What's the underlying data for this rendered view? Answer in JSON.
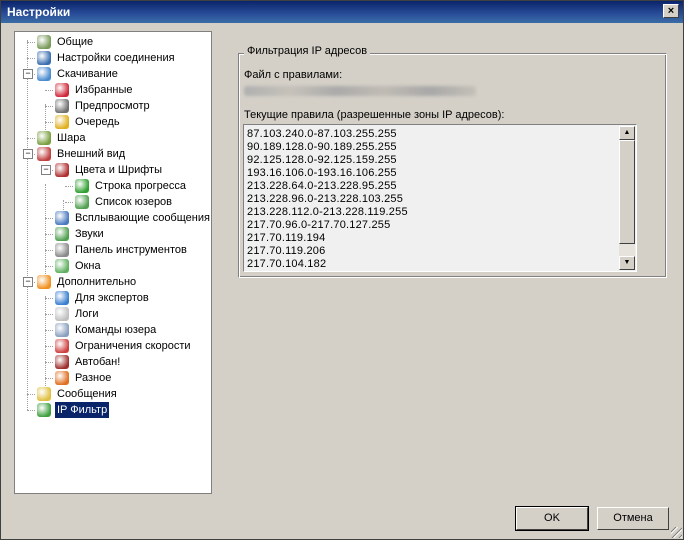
{
  "window": {
    "title": "Настройки",
    "close_label": "×"
  },
  "tree": [
    {
      "label": "Общие",
      "color": "#7a9a5a"
    },
    {
      "label": "Настройки соединения",
      "color": "#3b6fb0"
    },
    {
      "label": "Скачивание",
      "color": "#4a8bd0",
      "expanded": true
    },
    {
      "label": "Избранные",
      "color": "#d02a3a"
    },
    {
      "label": "Предпросмотр",
      "color": "#707070"
    },
    {
      "label": "Очередь",
      "color": "#e0b020"
    },
    {
      "label": "Шара",
      "color": "#7aa040"
    },
    {
      "label": "Внешний вид",
      "color": "#c04040",
      "expanded": true
    },
    {
      "label": "Цвета и Шрифты",
      "color": "#b03030",
      "expanded": true
    },
    {
      "label": "Строка прогресса",
      "color": "#30a030"
    },
    {
      "label": "Список юзеров",
      "color": "#50a050"
    },
    {
      "label": "Всплывающие сообщения",
      "color": "#4a7ac0"
    },
    {
      "label": "Звуки",
      "color": "#50a050"
    },
    {
      "label": "Панель инструментов",
      "color": "#8a8a8a"
    },
    {
      "label": "Окна",
      "color": "#60b060"
    },
    {
      "label": "Дополнительно",
      "color": "#f09020",
      "expanded": true
    },
    {
      "label": "Для экспертов",
      "color": "#3a80d0"
    },
    {
      "label": "Логи",
      "color": "#c0c0c0"
    },
    {
      "label": "Команды юзера",
      "color": "#8aa0c0"
    },
    {
      "label": "Ограничения скорости",
      "color": "#d04040"
    },
    {
      "label": "Автобан!",
      "color": "#a03030"
    },
    {
      "label": "Разное",
      "color": "#e07020"
    },
    {
      "label": "Сообщения",
      "color": "#e0c040"
    },
    {
      "label": "IP Фильтр",
      "color": "#40a040",
      "selected": true
    }
  ],
  "panel": {
    "group_title": "Фильтрация IP адресов",
    "rules_file_label": "Файл с правилами:",
    "current_rules_label": "Текущие правила (разрешенные зоны IP адресов):",
    "rules": [
      "87.103.240.0-87.103.255.255",
      "90.189.128.0-90.189.255.255",
      "92.125.128.0-92.125.159.255",
      "193.16.106.0-193.16.106.255",
      "213.228.64.0-213.228.95.255",
      "213.228.96.0-213.228.103.255",
      "213.228.112.0-213.228.119.255",
      "217.70.96.0-217.70.127.255",
      "217.70.119.194",
      "217.70.119.206",
      "217.70.104.182"
    ]
  },
  "buttons": {
    "ok": "OK",
    "cancel": "Отмена"
  },
  "icons": {
    "scroll_up": "▲",
    "scroll_down": "▼"
  }
}
